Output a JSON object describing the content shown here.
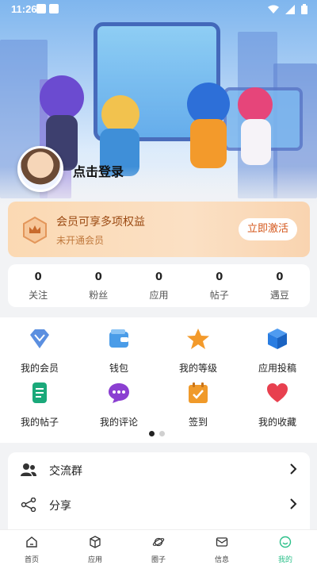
{
  "status_bar": {
    "time": "11:26"
  },
  "profile": {
    "login_text": "点击登录"
  },
  "member": {
    "title": "会员可享多项权益",
    "subtitle": "未开通会员",
    "activate_label": "立即激活"
  },
  "stats": [
    {
      "value": "0",
      "label": "关注"
    },
    {
      "value": "0",
      "label": "粉丝"
    },
    {
      "value": "0",
      "label": "应用"
    },
    {
      "value": "0",
      "label": "帖子"
    },
    {
      "value": "0",
      "label": "遇豆"
    }
  ],
  "grid": {
    "row1": [
      {
        "label": "我的会员",
        "icon": "diamond-icon",
        "color": "#5b8fe0"
      },
      {
        "label": "钱包",
        "icon": "wallet-icon",
        "color": "#4a9ce8"
      },
      {
        "label": "我的等级",
        "icon": "star-icon",
        "color": "#f39a2b"
      },
      {
        "label": "应用投稿",
        "icon": "cube-icon",
        "color": "#2a7de1"
      }
    ],
    "row2": [
      {
        "label": "我的帖子",
        "icon": "scroll-icon",
        "color": "#1aa97a"
      },
      {
        "label": "我的评论",
        "icon": "chat-bubble-icon",
        "color": "#8b3fd1"
      },
      {
        "label": "签到",
        "icon": "calendar-check-icon",
        "color": "#f09a2a"
      },
      {
        "label": "我的收藏",
        "icon": "heart-icon",
        "color": "#e8404f"
      }
    ]
  },
  "list": [
    {
      "label": "交流群",
      "icon": "group-icon"
    },
    {
      "label": "分享",
      "icon": "share-icon"
    }
  ],
  "nav": [
    {
      "label": "首页",
      "icon": "home-icon"
    },
    {
      "label": "应用",
      "icon": "box-icon"
    },
    {
      "label": "圈子",
      "icon": "planet-icon"
    },
    {
      "label": "信息",
      "icon": "mail-icon"
    },
    {
      "label": "我的",
      "icon": "smile-icon",
      "active": true
    }
  ],
  "colors": {
    "accent": "#2cc08a",
    "member_text": "#9b4a13",
    "activate_text": "#d4561a"
  }
}
